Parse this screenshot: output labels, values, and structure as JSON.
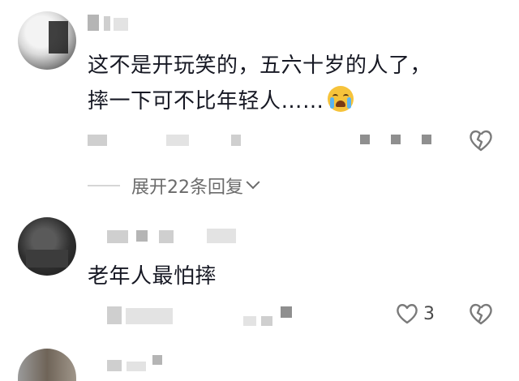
{
  "comments": [
    {
      "text_line1": "这不是开玩笑的，五六十岁的人了，",
      "text_line2": "摔一下可不比年轻人……",
      "emoji": "crying-face-icon",
      "more_replies_label": "展开22条回复"
    },
    {
      "text": "老年人最怕摔",
      "like_count": "3"
    }
  ],
  "icons": {
    "dislike": "broken-heart-icon",
    "like": "heart-icon",
    "expand": "chevron-down-icon"
  },
  "colors": {
    "text": "#161823",
    "secondary": "#6b6b6b",
    "icon": "#7a7a7a"
  }
}
